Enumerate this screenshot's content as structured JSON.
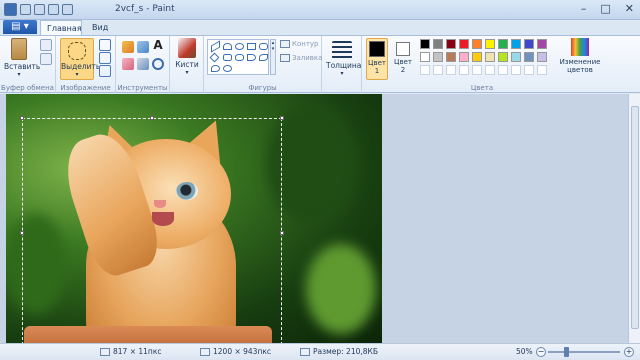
{
  "window": {
    "title": "2vcf_s - Paint",
    "controls": {
      "minimize": "–",
      "maximize": "□",
      "close": "✕"
    }
  },
  "tabs": {
    "file": "▤ ▾",
    "home": "Главная",
    "view": "Вид"
  },
  "ribbon": {
    "clipboard": {
      "paste": "Вставить",
      "label": "Буфер обмена"
    },
    "image": {
      "select": "Выделить",
      "label": "Изображение"
    },
    "tools": {
      "label": "Инструменты",
      "text_icon": "A"
    },
    "brushes": {
      "label": "Кисти"
    },
    "shapes": {
      "label": "Фигуры",
      "outline": "Контур",
      "fill": "Заливка"
    },
    "size": {
      "label": "Толщина"
    },
    "colors": {
      "color1": "Цвет\n1",
      "color2": "Цвет\n2",
      "edit": "Изменение цветов",
      "label": "Цвета",
      "palette_row1": [
        "#000000",
        "#7f7f7f",
        "#880015",
        "#ed1c24",
        "#ff7f27",
        "#fff200",
        "#22b14c",
        "#00a2e8",
        "#3f48cc",
        "#a349a4"
      ],
      "palette_row2": [
        "#ffffff",
        "#c3c3c3",
        "#b97a57",
        "#ffaec9",
        "#ffc90e",
        "#efe4b0",
        "#b5e61d",
        "#99d9ea",
        "#7092be",
        "#c8bfe7"
      ],
      "color1_value": "#000000",
      "color2_value": "#ffffff"
    }
  },
  "status": {
    "cursor": "817 × 11пкс",
    "dimensions": "1200 × 943пкс",
    "filesize": "Размер: 210,8КБ",
    "zoom": "50%"
  }
}
